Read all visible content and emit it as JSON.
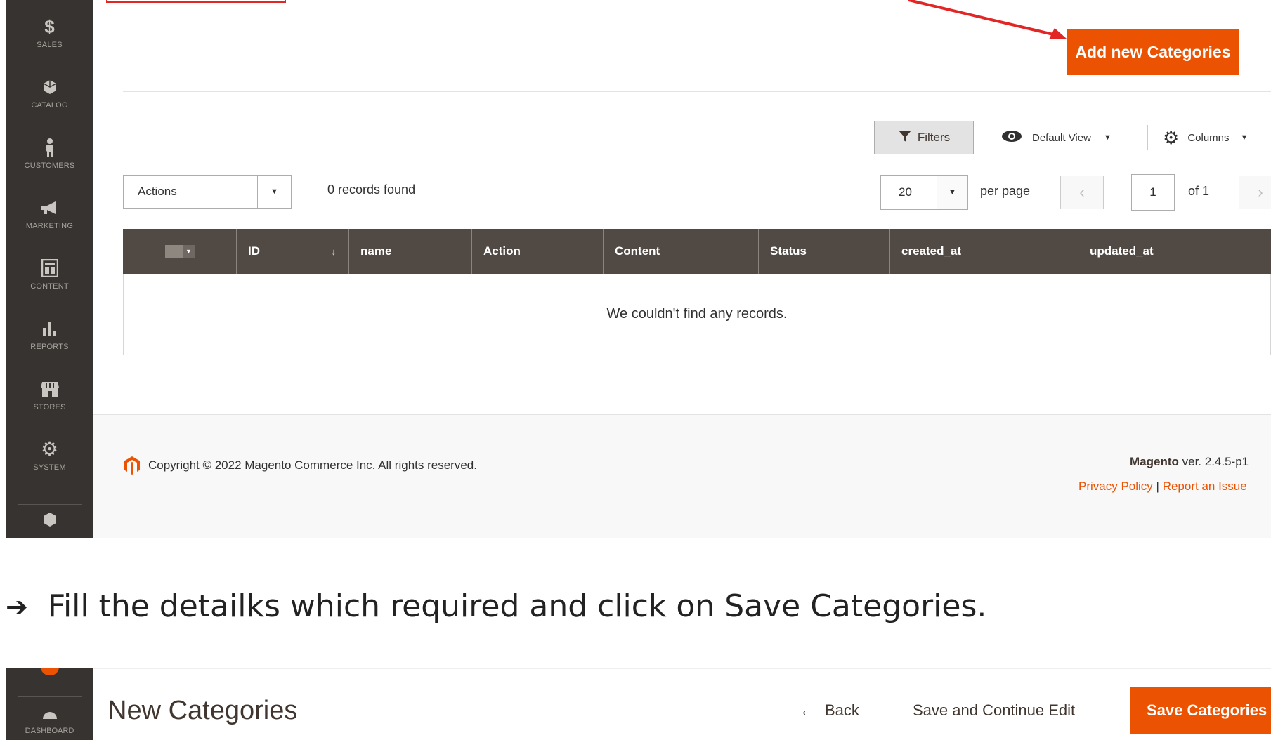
{
  "screenshot1": {
    "sidebar": {
      "items": [
        {
          "label": "SALES",
          "icon": "dollar-icon"
        },
        {
          "label": "CATALOG",
          "icon": "cube-icon"
        },
        {
          "label": "CUSTOMERS",
          "icon": "person-icon"
        },
        {
          "label": "MARKETING",
          "icon": "megaphone-icon"
        },
        {
          "label": "CONTENT",
          "icon": "layout-icon"
        },
        {
          "label": "REPORTS",
          "icon": "bar-chart-icon"
        },
        {
          "label": "STORES",
          "icon": "storefront-icon"
        },
        {
          "label": "SYSTEM",
          "icon": "gear-icon"
        }
      ]
    },
    "add_button": "Add new Categories",
    "toolbar": {
      "filters": "Filters",
      "default_view": "Default View",
      "columns": "Columns"
    },
    "actions_select": "Actions",
    "records_found": "0 records found",
    "pagination": {
      "per_page_value": "20",
      "per_page_label": "per page",
      "current_page": "1",
      "of_label": "of 1"
    },
    "grid": {
      "columns": [
        "ID",
        "name",
        "Action",
        "Content",
        "Status",
        "created_at",
        "updated_at"
      ],
      "empty_message": "We couldn't find any records."
    },
    "footer": {
      "copyright": "Copyright © 2022 Magento Commerce Inc. All rights reserved.",
      "brand": "Magento",
      "version": "ver. 2.4.5-p1",
      "privacy": "Privacy Policy",
      "separator": "|",
      "report": "Report an Issue"
    },
    "accent_color": "#eb5202",
    "annotation_color": "#e22626"
  },
  "instruction": {
    "arrow": "➔",
    "text": "Fill the detailks which required and click on Save Categories."
  },
  "screenshot2": {
    "sidebar_label": "DASHBOARD",
    "page_title": "New Categories",
    "back": "Back",
    "save_continue": "Save and Continue Edit",
    "save": "Save Categories"
  }
}
